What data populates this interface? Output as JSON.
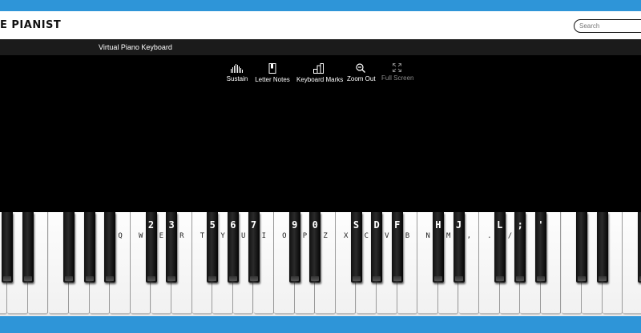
{
  "header": {
    "logo": "E PIANIST",
    "search_placeholder": "Search"
  },
  "titlebar": {
    "title": "Virtual Piano Keyboard"
  },
  "toolbar": {
    "items": [
      {
        "label": "Sustain",
        "icon": "sustain-bars-icon"
      },
      {
        "label": "Letter Notes",
        "icon": "note-letter-icon"
      },
      {
        "label": "Keyboard Marks",
        "icon": "keyboard-marks-icon"
      },
      {
        "label": "Zoom Out",
        "icon": "zoom-out-icon"
      },
      {
        "label": "Full Screen",
        "icon": "fullscreen-icon",
        "disabled": true
      }
    ]
  },
  "keyboard": {
    "black_key_labels": [
      "2",
      "3",
      "5",
      "6",
      "7",
      "9",
      "0",
      "S",
      "D",
      "F",
      "H",
      "J",
      "L",
      ";",
      "'"
    ],
    "white_key_labels": [
      "Q",
      "W",
      "E",
      "R",
      "T",
      "Y",
      "U",
      "I",
      "O",
      "P",
      "Z",
      "X",
      "C",
      "V",
      "B",
      "N",
      "M",
      ",",
      ".",
      "/"
    ]
  },
  "colors": {
    "frame_blue": "#2e95d8",
    "titlebar": "#1b1b1b",
    "stage": "#000000"
  }
}
